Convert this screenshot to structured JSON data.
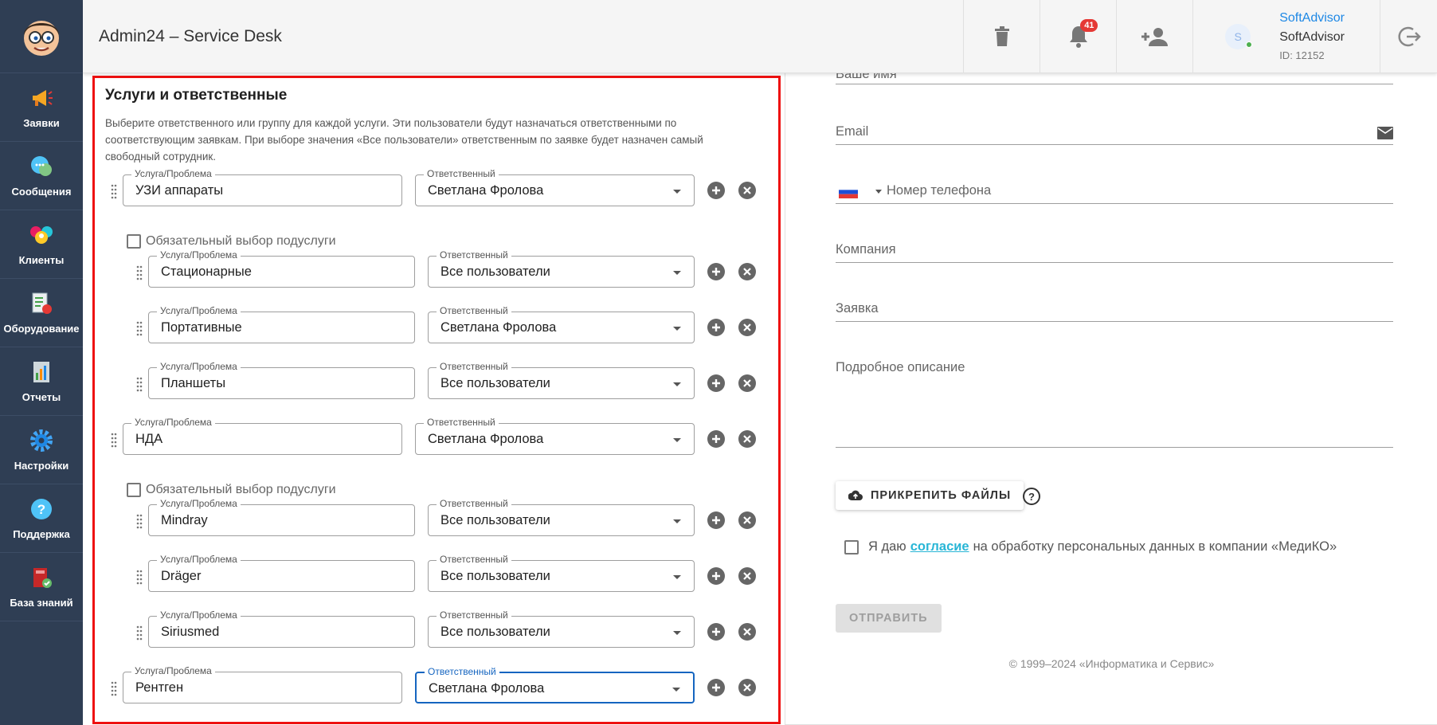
{
  "header": {
    "title": "Admin24 – Service Desk",
    "notifications_count": "41",
    "user": {
      "avatar_letter": "S",
      "link_name": "SoftAdvisor",
      "name": "SoftAdvisor",
      "id_text": "ID: 12152"
    }
  },
  "sidebar": {
    "items": [
      {
        "label": "Заявки",
        "icon": "megaphone-icon"
      },
      {
        "label": "Сообщения",
        "icon": "chat-icon"
      },
      {
        "label": "Клиенты",
        "icon": "clients-icon"
      },
      {
        "label": "Оборудование",
        "icon": "equipment-icon"
      },
      {
        "label": "Отчеты",
        "icon": "report-icon"
      },
      {
        "label": "Настройки",
        "icon": "gear-icon"
      },
      {
        "label": "Поддержка",
        "icon": "help-icon"
      },
      {
        "label": "База знаний",
        "icon": "book-icon"
      }
    ]
  },
  "services": {
    "title": "Услуги и ответственные",
    "description": "Выберите ответственного или группу для каждой услуги. Эти пользователи будут назначаться ответственными по соответствующим заявкам. При выборе значения «Все пользователи» ответственным по заявке будет назначен самый свободный сотрудник.",
    "service_label": "Услуга/Проблема",
    "responsible_label": "Ответственный",
    "mandatory_label": "Обязательный выбор подуслуги",
    "rows": [
      {
        "service": "УЗИ аппараты",
        "responsible": "Светлана Фролова"
      },
      {
        "service": "Стационарные",
        "responsible": "Все пользователи"
      },
      {
        "service": "Портативные",
        "responsible": "Светлана Фролова"
      },
      {
        "service": "Планшеты",
        "responsible": "Все пользователи"
      },
      {
        "service": "НДА",
        "responsible": "Светлана Фролова"
      },
      {
        "service": "Mindray",
        "responsible": "Все пользователи"
      },
      {
        "service": "Dräger",
        "responsible": "Все пользователи"
      },
      {
        "service": "Siriusmed",
        "responsible": "Все пользователи"
      },
      {
        "service": "Рентген",
        "responsible": "Светлана Фролова"
      }
    ]
  },
  "form": {
    "name_label": "Ваше имя",
    "email_label": "Email",
    "phone_label": "Номер телефона",
    "company_label": "Компания",
    "request_label": "Заявка",
    "description_label": "Подробное описание",
    "attach_label": "ПРИКРЕПИТЬ ФАЙЛЫ",
    "help_glyph": "?",
    "consent_before": "Я даю",
    "consent_link": "согласие",
    "consent_after": "на обработку персональных данных в компании «МедиКО»",
    "submit_label": "ОТПРАВИТЬ",
    "copyright": "© 1999–2024 «Информатика и Сервис»"
  }
}
